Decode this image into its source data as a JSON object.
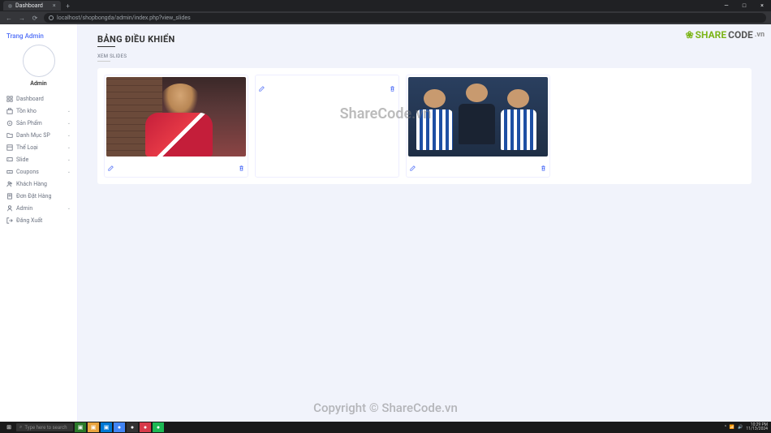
{
  "browser": {
    "tab_title": "Dashboard",
    "url": "localhost/shopbongda/admin/index.php?view_slides"
  },
  "sidebar": {
    "brand": "Trang Admin",
    "username": "Admin",
    "items": [
      {
        "label": "Dashboard",
        "icon": "dashboard",
        "expandable": false
      },
      {
        "label": "Tồn kho",
        "icon": "inventory",
        "expandable": true
      },
      {
        "label": "Sản Phẩm",
        "icon": "product",
        "expandable": true
      },
      {
        "label": "Danh Mục SP",
        "icon": "category",
        "expandable": true
      },
      {
        "label": "Thể Loại",
        "icon": "type",
        "expandable": true
      },
      {
        "label": "Slide",
        "icon": "slide",
        "expandable": true
      },
      {
        "label": "Coupons",
        "icon": "coupon",
        "expandable": true
      },
      {
        "label": "Khách Hàng",
        "icon": "customer",
        "expandable": false
      },
      {
        "label": "Đơn Đặt Hàng",
        "icon": "order",
        "expandable": false
      },
      {
        "label": "Admin",
        "icon": "admin",
        "expandable": true
      },
      {
        "label": "Đăng Xuất",
        "icon": "logout",
        "expandable": false
      }
    ]
  },
  "main": {
    "title": "BẢNG ĐIỀU KHIỂN",
    "subtitle": "XEM SLIDES",
    "slides": [
      {
        "edit": "edit",
        "delete": "delete"
      },
      {
        "edit": "edit",
        "delete": "delete"
      },
      {
        "edit": "edit",
        "delete": "delete"
      }
    ]
  },
  "watermark": {
    "logo_share": "SHARE",
    "logo_code": "CODE",
    "logo_vn": ".vn",
    "center": "ShareCode.vn",
    "bottom": "Copyright © ShareCode.vn"
  },
  "taskbar": {
    "search_placeholder": "Type here to search",
    "time": "10:29 PM",
    "date": "11/13/2024"
  }
}
